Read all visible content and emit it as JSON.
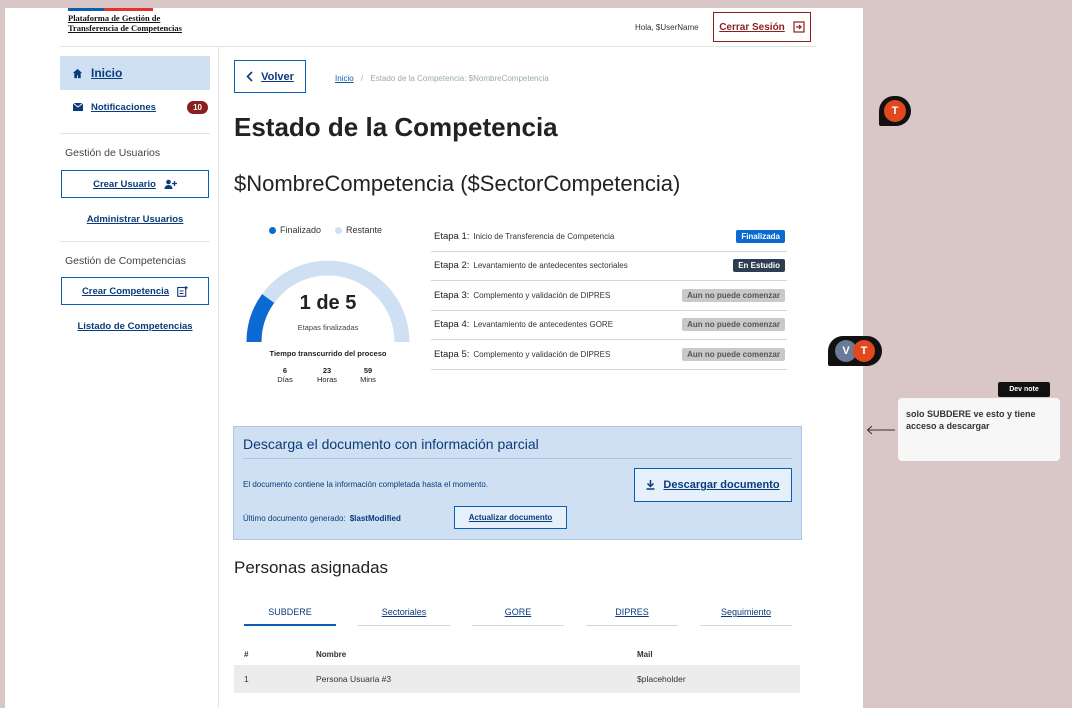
{
  "header": {
    "brand": "Plataforma de Gestión de Transferencia de Competencias",
    "greeting": "Hola, $UserName",
    "logout_label": "Cerrar Sesión",
    "colors": {
      "blue": "#0a5fb4",
      "red": "#e0342f",
      "logout": "#8a1f1f"
    }
  },
  "sidebar": {
    "home_label": "Inicio",
    "notifications_label": "Notificaciones",
    "notifications_count": "10",
    "users_section": "Gestión de Usuarios",
    "create_user_label": "Crear Usuario",
    "manage_users_label": "Administrar Usuarios",
    "competencies_section": "Gestión de Competencias",
    "create_competency_label": "Crear Competencia",
    "list_competencies_label": "Listado de Competencias",
    "icons": [
      "home-icon",
      "mail-icon",
      "add-user-icon",
      "add-document-icon"
    ]
  },
  "main": {
    "back_label": "Volver",
    "breadcrumb_home": "Inicio",
    "breadcrumb_sep": "/",
    "breadcrumb_current": "Estado de la Competencia: $NombreCompetencia",
    "title": "Estado de la Competencia",
    "competency_title": "$NombreCompetencia ($SectorCompetencia)",
    "progress": {
      "legend_done": "Finalizado",
      "legend_remaining": "Restante",
      "completed": 1,
      "total": 5,
      "value_text": "1 de 5",
      "caption": "Etapas finalizadas",
      "elapsed_label": "Tiempo transcurrido del proceso",
      "days": "6",
      "days_label": "Días",
      "hours": "23",
      "hours_label": "Horas",
      "mins": "59",
      "mins_label": "Mins",
      "colors": {
        "done": "#0a6ad1",
        "remaining": "#cfe0f3"
      }
    },
    "stages": [
      {
        "num": "Etapa 1:",
        "desc": "Inicio de Transferencia de Competencia",
        "status": "Finalizada",
        "kind": "done"
      },
      {
        "num": "Etapa 2:",
        "desc": "Levantamiento de antedecentes sectoriales",
        "status": "En Estudio",
        "kind": "study"
      },
      {
        "num": "Etapa 3:",
        "desc": "Complemento y validación de DIPRES",
        "status": "Aun no puede comenzar",
        "kind": "wait"
      },
      {
        "num": "Etapa 4:",
        "desc": "Levantamiento de antecedentes GORE",
        "status": "Aun no puede comenzar",
        "kind": "wait"
      },
      {
        "num": "Etapa 5:",
        "desc": "Complemento y validación de DIPRES",
        "status": "Aun no puede comenzar",
        "kind": "wait"
      }
    ],
    "download": {
      "title": "Descarga el documento con información parcial",
      "text": "El documento contiene la información completada hasta el momento.",
      "button_label": "Descargar documento",
      "last_label": "Último documento generado:",
      "last_value": "$lastModified",
      "update_label": "Actualizar documento"
    },
    "people": {
      "title": "Personas asignadas",
      "tabs": [
        "SUBDERE",
        "Sectoriales",
        "GORE",
        "DIPRES",
        "Seguimiento"
      ],
      "columns": [
        "#",
        "Nombre",
        "Mail"
      ],
      "rows": [
        {
          "index": "1",
          "name": "Persona Usuaria #3",
          "mail": "$placeholder"
        }
      ]
    }
  },
  "comments": {
    "avatar_1": "T",
    "avatar_2a": "V",
    "avatar_2b": "T",
    "dev_tag": "Dev note",
    "dev_note": "solo SUBDERE ve esto y tiene acceso a descargar"
  }
}
